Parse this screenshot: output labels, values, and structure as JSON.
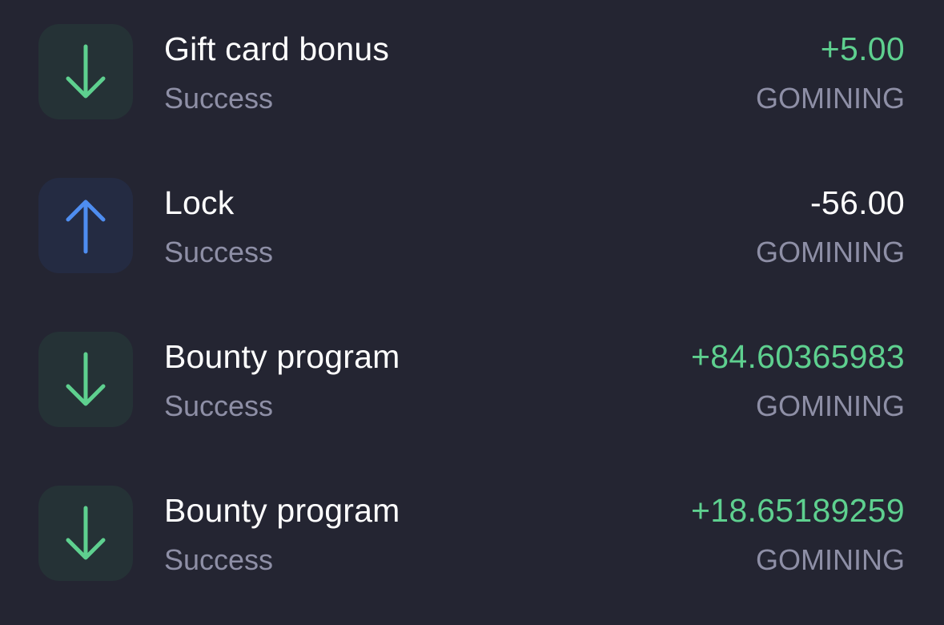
{
  "colors": {
    "background": "#242532",
    "in_tile": "#253236",
    "out_tile": "#242b42",
    "positive": "#5ed08f",
    "neutral": "#ffffff",
    "out_arrow": "#4e8df0",
    "muted": "#8e8fa6"
  },
  "transactions": [
    {
      "direction": "in",
      "icon": "arrow-down-icon",
      "title": "Gift card bonus",
      "status": "Success",
      "amount": "+5.00",
      "currency": "GOMINING"
    },
    {
      "direction": "out",
      "icon": "arrow-up-icon",
      "title": "Lock",
      "status": "Success",
      "amount": "-56.00",
      "currency": "GOMINING"
    },
    {
      "direction": "in",
      "icon": "arrow-down-icon",
      "title": "Bounty program",
      "status": "Success",
      "amount": "+84.60365983",
      "currency": "GOMINING"
    },
    {
      "direction": "in",
      "icon": "arrow-down-icon",
      "title": "Bounty program",
      "status": "Success",
      "amount": "+18.65189259",
      "currency": "GOMINING"
    }
  ]
}
